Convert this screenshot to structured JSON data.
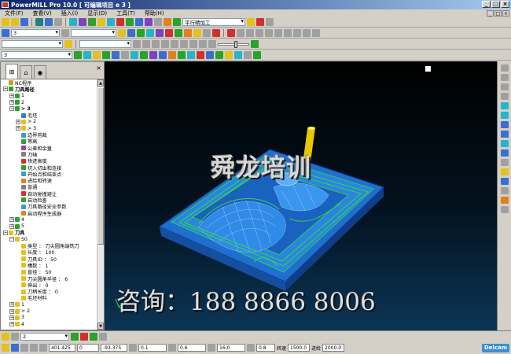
{
  "window": {
    "title": "PowerMILL Pro 10.0    [ 可编辑项目 e 3 ]",
    "controls": [
      "_",
      "□",
      "×"
    ]
  },
  "menu": [
    "文件(F)",
    "查看(V)",
    "插入(I)",
    "显示(D)",
    "工具(T)",
    "帮助(H)"
  ],
  "toolbar1": {
    "strategy_combo": "平行精加工"
  },
  "toolbar2": {
    "combo_value": "3"
  },
  "toolbar3": {
    "combo_value": ""
  },
  "toolbar4": {
    "combo_value": "3"
  },
  "explorer": {
    "tree": [
      {
        "indent": 0,
        "label": "NC程序",
        "icon": "folder-icon",
        "color": "#c0a020",
        "expander": ""
      },
      {
        "indent": 0,
        "label": "刀具路径",
        "icon": "toolpath-folder-icon",
        "color": "#2aa32a",
        "expander": "−",
        "bold": true
      },
      {
        "indent": 1,
        "label": "1",
        "icon": "toolpath-icon",
        "color": "#2aa32a",
        "expander": "+"
      },
      {
        "indent": 1,
        "label": "2",
        "icon": "toolpath-icon",
        "color": "#2aa32a",
        "expander": "+"
      },
      {
        "indent": 1,
        "label": "> 3",
        "icon": "toolpath-icon",
        "color": "#2aa32a",
        "expander": "−",
        "bold": true
      },
      {
        "indent": 2,
        "label": "毛坯",
        "icon": "block-icon",
        "color": "#2a7fd0",
        "expander": ""
      },
      {
        "indent": 2,
        "label": "> 2",
        "icon": "tool-icon",
        "color": "#e4c020",
        "expander": "+"
      },
      {
        "indent": 2,
        "label": "> 3",
        "icon": "tool-icon",
        "color": "#e4c020",
        "expander": "+"
      },
      {
        "indent": 2,
        "label": "边界剪裁",
        "icon": "boundary-icon",
        "color": "#30a0d0",
        "expander": ""
      },
      {
        "indent": 2,
        "label": "等高",
        "icon": "strategy-icon",
        "color": "#2aa32a",
        "expander": ""
      },
      {
        "indent": 2,
        "label": "公差和余量",
        "icon": "tolerance-icon",
        "color": "#a040a0",
        "expander": ""
      },
      {
        "indent": 2,
        "label": "刀轴",
        "icon": "tool-axis-icon",
        "color": "#808080",
        "expander": ""
      },
      {
        "indent": 2,
        "label": "快进高度",
        "icon": "rapid-height-icon",
        "color": "#d03030",
        "expander": ""
      },
      {
        "indent": 2,
        "label": "切入切出和连接",
        "icon": "leads-links-icon",
        "color": "#2aa32a",
        "expander": ""
      },
      {
        "indent": 2,
        "label": "开始点和结束点",
        "icon": "start-end-icon",
        "color": "#30a0d0",
        "expander": ""
      },
      {
        "indent": 2,
        "label": "进给和转速",
        "icon": "feeds-speeds-icon",
        "color": "#e08020",
        "expander": ""
      },
      {
        "indent": 2,
        "label": "普通",
        "icon": "general-icon",
        "color": "#808080",
        "expander": ""
      },
      {
        "indent": 2,
        "label": "自动碰撞避让",
        "icon": "collision-icon",
        "color": "#d03030",
        "expander": ""
      },
      {
        "indent": 2,
        "label": "自动检查",
        "icon": "check-icon",
        "color": "#2aa32a",
        "expander": ""
      },
      {
        "indent": 2,
        "label": "刀具路径安全参数",
        "icon": "safety-icon",
        "color": "#30a0d0",
        "expander": ""
      },
      {
        "indent": 2,
        "label": "启动程序生成器",
        "icon": "generator-icon",
        "color": "#e08020",
        "expander": ""
      },
      {
        "indent": 1,
        "label": "4",
        "icon": "toolpath-icon",
        "color": "#2aa32a",
        "expander": "+"
      },
      {
        "indent": 1,
        "label": "5",
        "icon": "toolpath-icon",
        "color": "#2aa32a",
        "expander": "+"
      },
      {
        "indent": 0,
        "label": "刀具",
        "icon": "tools-folder-icon",
        "color": "#e4c020",
        "expander": "−",
        "bold": true
      },
      {
        "indent": 1,
        "label": "50",
        "icon": "tool-icon",
        "color": "#e4c020",
        "expander": "−"
      },
      {
        "indent": 2,
        "label": "类型 ： 刀尖圆角端铣刀",
        "icon": "param-icon",
        "color": "#e4c020",
        "expander": ""
      },
      {
        "indent": 2,
        "label": "长度 ： 100",
        "icon": "param-icon",
        "color": "#e4c020",
        "expander": ""
      },
      {
        "indent": 2,
        "label": "刀具ID ： 50",
        "icon": "param-icon",
        "color": "#e4c020",
        "expander": ""
      },
      {
        "indent": 2,
        "label": "槽数 ： 1",
        "icon": "param-icon",
        "color": "#e4c020",
        "expander": ""
      },
      {
        "indent": 2,
        "label": "直径 ： 50",
        "icon": "param-icon",
        "color": "#e4c020",
        "expander": ""
      },
      {
        "indent": 2,
        "label": "刀尖圆角半径 ： 6",
        "icon": "param-icon",
        "color": "#e4c020",
        "expander": ""
      },
      {
        "indent": 2,
        "label": "伸出 ： 0",
        "icon": "param-icon",
        "color": "#e4c020",
        "expander": ""
      },
      {
        "indent": 2,
        "label": "刀柄长度 ： 0",
        "icon": "param-icon",
        "color": "#e4c020",
        "expander": ""
      },
      {
        "indent": 2,
        "label": "毛坯材料",
        "icon": "material-icon",
        "color": "#e4c020",
        "expander": ""
      },
      {
        "indent": 1,
        "label": "1",
        "icon": "tool-icon",
        "color": "#e4c020",
        "expander": "+"
      },
      {
        "indent": 1,
        "label": "> 2",
        "icon": "tool-icon",
        "color": "#e4c020",
        "expander": "+"
      },
      {
        "indent": 1,
        "label": "3",
        "icon": "tool-icon",
        "color": "#e4c020",
        "expander": "+"
      },
      {
        "indent": 1,
        "label": "4",
        "icon": "tool-icon",
        "color": "#e4c020",
        "expander": "+"
      }
    ]
  },
  "viewport": {
    "watermark_title": "舜龙培训",
    "watermark_contact": "咨询：188 8866 8006"
  },
  "status": {
    "row1_combo": "2",
    "x": "401.425",
    "y": "0",
    "z": "-93.375",
    "tolerance": "0.1",
    "stepover": "0.6",
    "angle": "16.0",
    "thickness": "0.8",
    "spindle_label": "转速",
    "spindle": "1500.0",
    "feed_label": "进给",
    "feed": "2000.0",
    "brand": "Delcam"
  },
  "colors": {
    "part_blue": "#2a7fd0",
    "toolpath_green": "#38e038",
    "tool_yellow": "#e8c800",
    "titlebar": "#0a246a"
  }
}
